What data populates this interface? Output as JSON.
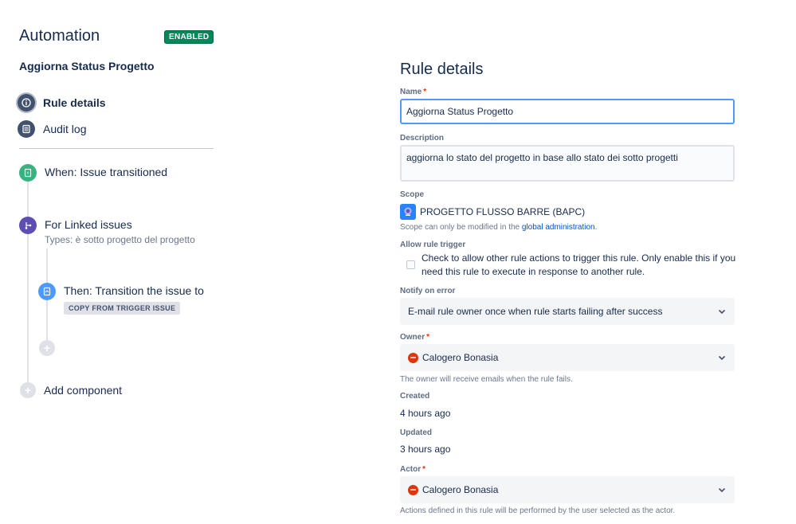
{
  "app": {
    "title": "Automation",
    "status_badge": "ENABLED"
  },
  "rule": {
    "name": "Aggiorna Status Progetto"
  },
  "nav": {
    "rule_details": "Rule details",
    "audit_log": "Audit log"
  },
  "flow": {
    "trigger": {
      "title": "When: Issue transitioned"
    },
    "branch": {
      "title": "For Linked issues",
      "subtitle": "Types: è sotto progetto del progetto"
    },
    "action": {
      "title": "Then: Transition the issue to",
      "chip": "COPY FROM TRIGGER ISSUE"
    },
    "add_component": "Add component"
  },
  "details": {
    "title": "Rule details",
    "name_label": "Name",
    "name_value": "Aggiorna Status Progetto",
    "description_label": "Description",
    "description_value": "aggiorna lo stato del progetto in base allo stato dei sotto progetti",
    "scope_label": "Scope",
    "scope_value": "PROGETTO FLUSSO BARRE (BAPC)",
    "scope_help_prefix": "Scope can only be modified in the ",
    "scope_help_link": "global administration",
    "scope_help_suffix": ".",
    "allow_trigger_label": "Allow rule trigger",
    "allow_trigger_text": "Check to allow other rule actions to trigger this rule. Only enable this if you need this rule to execute in response to another rule.",
    "notify_label": "Notify on error",
    "notify_value": "E-mail rule owner once when rule starts failing after success",
    "owner_label": "Owner",
    "owner_value": "Calogero Bonasia",
    "owner_help": "The owner will receive emails when the rule fails.",
    "created_label": "Created",
    "created_value": "4 hours ago",
    "updated_label": "Updated",
    "updated_value": "3 hours ago",
    "actor_label": "Actor",
    "actor_value": "Calogero Bonasia",
    "actor_help": "Actions defined in this rule will be performed by the user selected as the actor."
  },
  "colors": {
    "enabled": "#00875a",
    "trigger": "#36b37e",
    "branch": "#5e4db2",
    "action": "#4c9aff",
    "link": "#0052cc",
    "required": "#de350b"
  },
  "icons": {
    "rule_details": "info-icon",
    "audit_log": "list-icon",
    "trigger": "lightning-doc-icon",
    "branch": "branch-icon",
    "action": "doc-transition-icon",
    "add": "plus-icon",
    "dropdown": "chevron-down-icon"
  }
}
